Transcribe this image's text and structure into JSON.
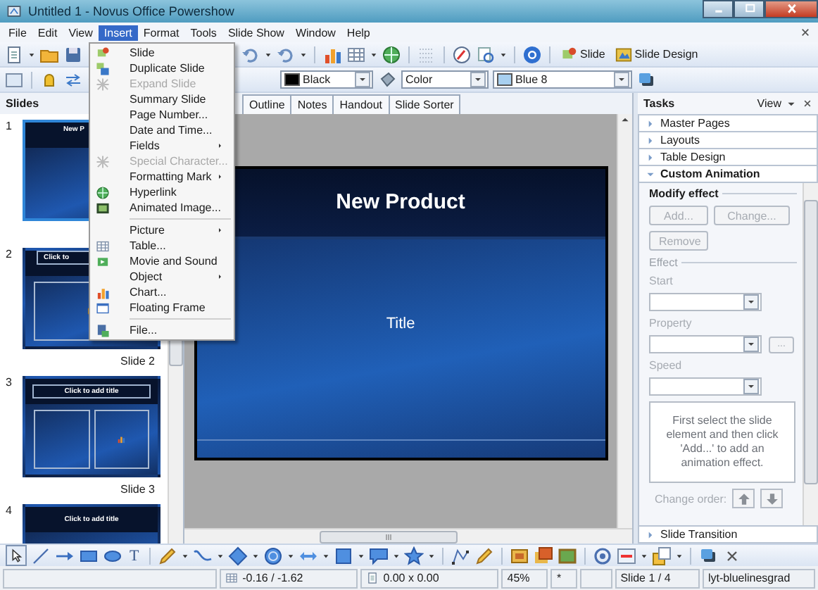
{
  "window": {
    "title": "Untitled 1 - Novus Office Powershow"
  },
  "menu_bar": [
    {
      "label": "File",
      "selected": false
    },
    {
      "label": "Edit",
      "selected": false
    },
    {
      "label": "View",
      "selected": false
    },
    {
      "label": "Insert",
      "selected": true
    },
    {
      "label": "Format",
      "selected": false
    },
    {
      "label": "Tools",
      "selected": false
    },
    {
      "label": "Slide Show",
      "selected": false
    },
    {
      "label": "Window",
      "selected": false
    },
    {
      "label": "Help",
      "selected": false
    }
  ],
  "insert_menu": [
    {
      "kind": "item",
      "label": "Slide",
      "disabled": false,
      "submenu": false
    },
    {
      "kind": "item",
      "label": "Duplicate Slide",
      "disabled": false,
      "submenu": false
    },
    {
      "kind": "item",
      "label": "Expand Slide",
      "disabled": true,
      "submenu": false
    },
    {
      "kind": "item",
      "label": "Summary Slide",
      "disabled": false,
      "submenu": false
    },
    {
      "kind": "item",
      "label": "Page Number...",
      "disabled": false,
      "submenu": false
    },
    {
      "kind": "item",
      "label": "Date and Time...",
      "disabled": false,
      "submenu": false
    },
    {
      "kind": "item",
      "label": "Fields",
      "disabled": false,
      "submenu": true
    },
    {
      "kind": "item",
      "label": "Special Character...",
      "disabled": true,
      "submenu": false
    },
    {
      "kind": "item",
      "label": "Formatting Mark",
      "disabled": false,
      "submenu": true
    },
    {
      "kind": "item",
      "label": "Hyperlink",
      "disabled": false,
      "submenu": false
    },
    {
      "kind": "item",
      "label": "Animated Image...",
      "disabled": false,
      "submenu": false
    },
    {
      "kind": "separator"
    },
    {
      "kind": "item",
      "label": "Picture",
      "disabled": false,
      "submenu": true
    },
    {
      "kind": "item",
      "label": "Table...",
      "disabled": false,
      "submenu": false
    },
    {
      "kind": "item",
      "label": "Movie and Sound",
      "disabled": false,
      "submenu": false
    },
    {
      "kind": "item",
      "label": "Object",
      "disabled": false,
      "submenu": true
    },
    {
      "kind": "item",
      "label": "Chart...",
      "disabled": false,
      "submenu": false
    },
    {
      "kind": "item",
      "label": "Floating Frame",
      "disabled": false,
      "submenu": false
    },
    {
      "kind": "separator"
    },
    {
      "kind": "item",
      "label": "File...",
      "disabled": false,
      "submenu": false
    }
  ],
  "standard_toolbar": {
    "buttons": [
      "Slide",
      "Slide Design"
    ]
  },
  "line_fill_toolbar": {
    "line_color": "Black",
    "area_style": "Color",
    "fill_color": "Blue 8"
  },
  "slides_panel": {
    "title": "Slides",
    "slides": [
      {
        "number": "1",
        "title": "New P",
        "kind": "title",
        "selected": true
      },
      {
        "number": "2",
        "title": "Click to",
        "label": "Slide 2",
        "kind": "content",
        "selected": false
      },
      {
        "number": "3",
        "title": "Click to add title",
        "label": "Slide 3",
        "kind": "two-content",
        "selected": false
      },
      {
        "number": "4",
        "title": "Click to add title",
        "kind": "title",
        "selected": false
      }
    ]
  },
  "view_tabs": [
    {
      "label": "Outline",
      "selected": false
    },
    {
      "label": "Notes",
      "selected": false
    },
    {
      "label": "Handout",
      "selected": false
    },
    {
      "label": "Slide Sorter",
      "selected": false
    }
  ],
  "slide": {
    "title": "New Product",
    "subtitle": "Title"
  },
  "tasks_panel": {
    "title": "Tasks",
    "view": "View",
    "sections": [
      {
        "label": "Master Pages",
        "expanded": false
      },
      {
        "label": "Layouts",
        "expanded": false
      },
      {
        "label": "Table Design",
        "expanded": false
      },
      {
        "label": "Custom Animation",
        "expanded": true
      }
    ],
    "modify_effect": {
      "title": "Modify effect",
      "buttons": [
        {
          "label": "Add...",
          "disabled": true
        },
        {
          "label": "Change...",
          "disabled": true
        },
        {
          "label": "Remove",
          "disabled": true
        }
      ]
    },
    "effect": {
      "title": "Effect",
      "fields": [
        {
          "label": "Start",
          "disabled": true
        },
        {
          "label": "Property",
          "disabled": true,
          "extra_button": "..."
        },
        {
          "label": "Speed",
          "disabled": true
        }
      ]
    },
    "hint": "First select the slide element and then click 'Add...' to add an animation effect.",
    "change_order": "Change order:",
    "footer_section": {
      "label": "Slide Transition",
      "expanded": false
    }
  },
  "drawing_toolbar": {
    "text_tool": "T"
  },
  "status_bar": {
    "position": "-0.16 / -1.62",
    "size": "0.00 x 0.00",
    "zoom": "45%",
    "modified": "*",
    "slide": "Slide 1 / 4",
    "layout": "lyt-bluelinesgrad"
  }
}
